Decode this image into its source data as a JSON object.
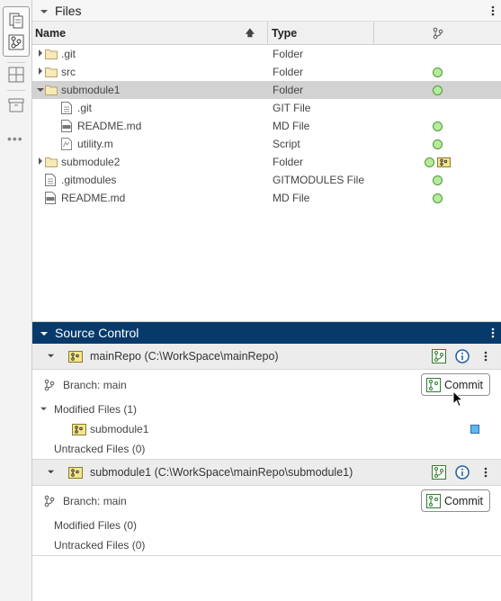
{
  "files_panel": {
    "title": "Files",
    "columns": {
      "name": "Name",
      "type": "Type"
    },
    "rows": [
      {
        "name": ".git",
        "type": "Folder",
        "kind": "folder",
        "expander": "collapsed",
        "indent": 0,
        "status": []
      },
      {
        "name": "src",
        "type": "Folder",
        "kind": "folder",
        "expander": "collapsed",
        "indent": 0,
        "status": [
          "unmodified"
        ]
      },
      {
        "name": "submodule1",
        "type": "Folder",
        "kind": "folder",
        "expander": "expanded",
        "indent": 0,
        "status": [
          "unmodified"
        ],
        "selected": true
      },
      {
        "name": ".git",
        "type": "GIT File",
        "kind": "file",
        "expander": "none",
        "indent": 1,
        "status": []
      },
      {
        "name": "README.md",
        "type": "MD File",
        "kind": "md",
        "expander": "none",
        "indent": 1,
        "status": [
          "unmodified"
        ]
      },
      {
        "name": "utility.m",
        "type": "Script",
        "kind": "script",
        "expander": "none",
        "indent": 1,
        "status": [
          "unmodified"
        ]
      },
      {
        "name": "submodule2",
        "type": "Folder",
        "kind": "folder",
        "expander": "collapsed",
        "indent": 0,
        "status": [
          "unmodified",
          "submodule"
        ]
      },
      {
        "name": ".gitmodules",
        "type": "GITMODULES File",
        "kind": "file",
        "expander": "none",
        "indent": 0,
        "status": [
          "unmodified"
        ]
      },
      {
        "name": "README.md",
        "type": "MD File",
        "kind": "md",
        "expander": "none",
        "indent": 0,
        "status": [
          "unmodified"
        ]
      }
    ]
  },
  "source_control": {
    "title": "Source Control",
    "repos": [
      {
        "name": "mainRepo (C:\\WorkSpace\\mainRepo)",
        "branch": "Branch: main",
        "commit_label": "Commit",
        "modified_header": "Modified Files (1)",
        "modified_files": [
          "submodule1"
        ],
        "untracked": "Untracked Files (0)"
      },
      {
        "name": "submodule1 (C:\\WorkSpace\\mainRepo\\submodule1)",
        "branch": "Branch: main",
        "commit_label": "Commit",
        "modified_header": "Modified Files (0)",
        "untracked": "Untracked Files (0)"
      }
    ]
  },
  "colors": {
    "accent_header": "#073a6b",
    "status_green": "#b7ea9c",
    "selected_row": "#d2d2d2",
    "changed_blue": "#5cb8ef"
  }
}
